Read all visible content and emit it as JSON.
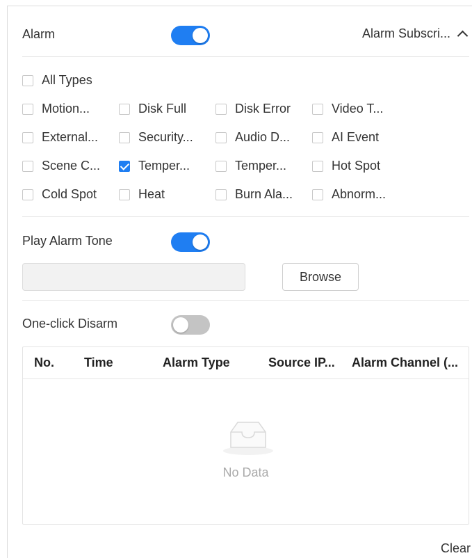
{
  "alarm": {
    "label": "Alarm",
    "enabled": true
  },
  "subscription": {
    "label": "Alarm Subscri...",
    "icon": "chevron-up-icon"
  },
  "all_types": {
    "label": "All Types",
    "checked": false
  },
  "alarm_types": [
    {
      "label": "Motion...",
      "checked": false
    },
    {
      "label": "Disk Full",
      "checked": false
    },
    {
      "label": "Disk Error",
      "checked": false
    },
    {
      "label": "Video T...",
      "checked": false
    },
    {
      "label": "External...",
      "checked": false
    },
    {
      "label": "Security...",
      "checked": false
    },
    {
      "label": "Audio D...",
      "checked": false
    },
    {
      "label": "AI Event",
      "checked": false
    },
    {
      "label": "Scene C...",
      "checked": false
    },
    {
      "label": "Temper...",
      "checked": true
    },
    {
      "label": "Temper...",
      "checked": false
    },
    {
      "label": "Hot Spot",
      "checked": false
    },
    {
      "label": "Cold Spot",
      "checked": false
    },
    {
      "label": "Heat",
      "checked": false
    },
    {
      "label": "Burn Ala...",
      "checked": false
    },
    {
      "label": "Abnorm...",
      "checked": false
    }
  ],
  "play_tone": {
    "label": "Play Alarm Tone",
    "enabled": true,
    "file_value": "",
    "browse_label": "Browse"
  },
  "disarm": {
    "label": "One-click Disarm",
    "enabled": false
  },
  "table": {
    "columns": [
      "No.",
      "Time",
      "Alarm Type",
      "Source IP...",
      "Alarm Channel (..."
    ],
    "rows": [],
    "empty_text": "No Data"
  },
  "clear_label": "Clear",
  "colors": {
    "accent": "#1f7ef2",
    "toggle_off": "#c4c4c4"
  }
}
